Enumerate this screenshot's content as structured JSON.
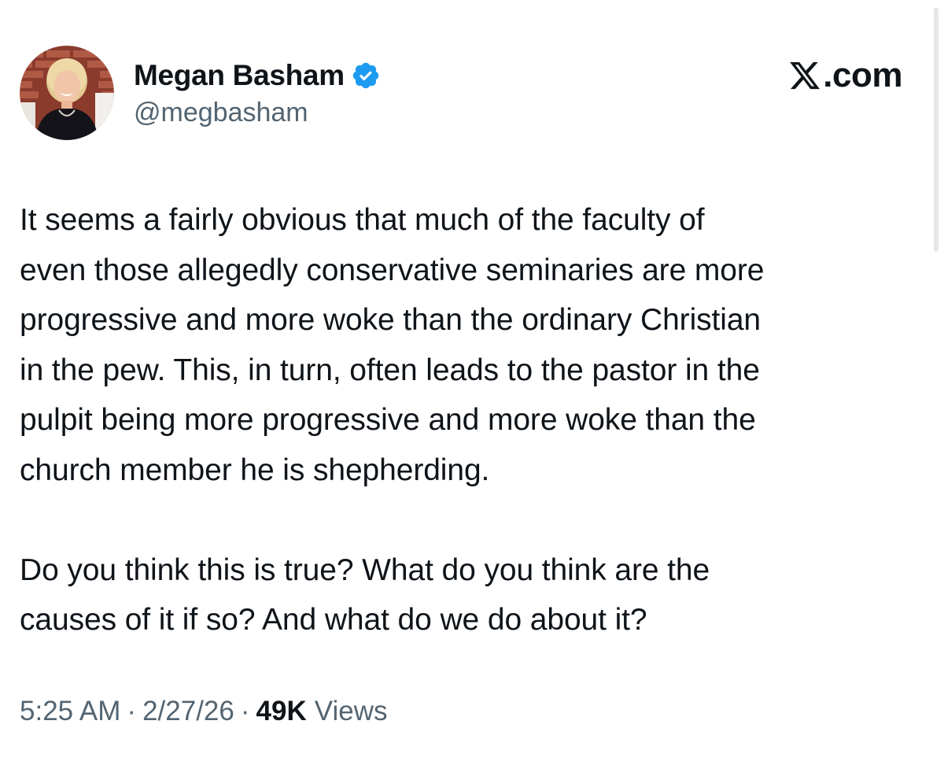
{
  "author": {
    "display_name": "Megan Basham",
    "handle": "@megbasham",
    "verified": true,
    "avatar_icon": "profile-photo"
  },
  "brand": {
    "text": ".com",
    "icon": "x-logo-icon"
  },
  "tweet": {
    "paragraphs": [
      "It seems a fairly obvious that much of the faculty of\neven those allegedly conservative seminaries are more\nprogressive and more woke than the ordinary Christian\nin the pew. This, in turn, often leads to the pastor in the\npulpit being more progressive and more woke than the\nchurch member he is shepherding.",
      "Do you think this is true? What do you think are the\ncauses of it if so? And what do we do about it?"
    ]
  },
  "meta": {
    "time": "5:25 AM",
    "separator": "·",
    "date": "2/27/26",
    "views_count": "49K",
    "views_label": "Views"
  },
  "colors": {
    "text_primary": "#0f1419",
    "text_secondary": "#536471",
    "verified_blue": "#1d9bf0"
  }
}
